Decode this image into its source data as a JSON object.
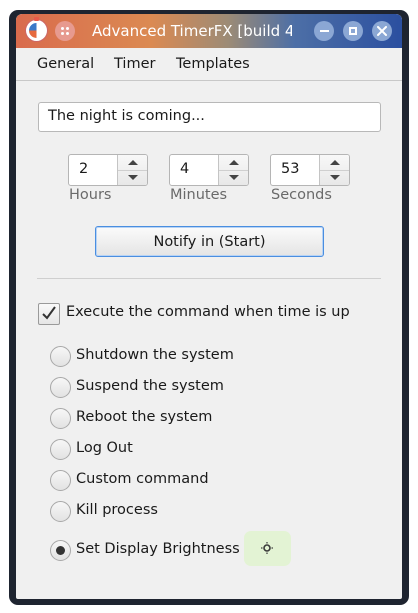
{
  "window": {
    "title": "Advanced TimerFX [build 4..."
  },
  "menu": {
    "items": [
      "General",
      "Timer",
      "Templates"
    ]
  },
  "message": {
    "value": "The night is coming..."
  },
  "timer": {
    "hours": {
      "value": "2",
      "label": "Hours"
    },
    "minutes": {
      "value": "4",
      "label": "Minutes"
    },
    "seconds": {
      "value": "53",
      "label": "Seconds"
    }
  },
  "notify_button": {
    "label": "Notify in (Start)"
  },
  "execute": {
    "label": "Execute the command when time is up",
    "checked": true
  },
  "actions": [
    {
      "label": "Shutdown the system",
      "selected": false
    },
    {
      "label": "Suspend the system",
      "selected": false
    },
    {
      "label": "Reboot the system",
      "selected": false
    },
    {
      "label": "Log Out",
      "selected": false
    },
    {
      "label": "Custom command",
      "selected": false
    },
    {
      "label": "Kill process",
      "selected": false
    },
    {
      "label": "Set Display Brightness",
      "selected": true
    }
  ],
  "icons": {
    "app": "timer-app-icon",
    "brightness": "brightness-icon"
  },
  "colors": {
    "accent_border": "#4a8ee0",
    "brightness_bg": "#e3f3d4"
  }
}
